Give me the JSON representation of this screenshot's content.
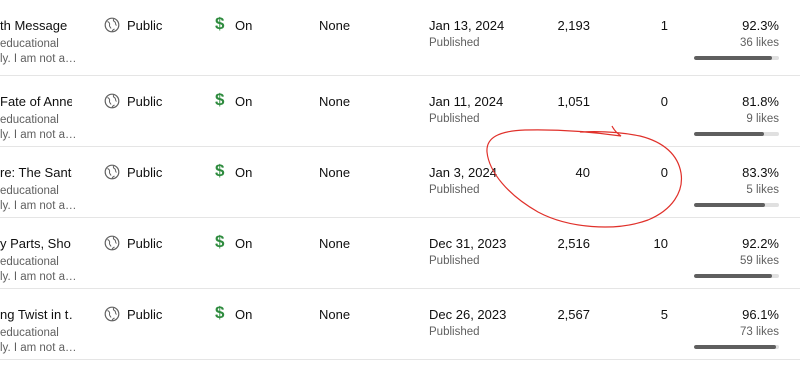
{
  "rows": [
    {
      "title": "th Message …",
      "desc1": "educational",
      "desc2": "ly. I am not a…",
      "visibility": "Public",
      "monetization": "On",
      "restrictions": "None",
      "date": "Jan 13, 2024",
      "status": "Published",
      "views": "2,193",
      "comments": "1",
      "like_pct": "92.3%",
      "likes": "36 likes",
      "like_ratio": 0.923
    },
    {
      "title": "Fate of Anne…",
      "desc1": "educational",
      "desc2": "ly. I am not a…",
      "visibility": "Public",
      "monetization": "On",
      "restrictions": "None",
      "date": "Jan 11, 2024",
      "status": "Published",
      "views": "1,051",
      "comments": "0",
      "like_pct": "81.8%",
      "likes": "9 likes",
      "like_ratio": 0.818
    },
    {
      "title": "re: The Santa…",
      "desc1": "educational",
      "desc2": "ly. I am not a…",
      "visibility": "Public",
      "monetization": "On",
      "restrictions": "None",
      "date": "Jan 3, 2024",
      "status": "Published",
      "views": "40",
      "comments": "0",
      "like_pct": "83.3%",
      "likes": "5 likes",
      "like_ratio": 0.833
    },
    {
      "title": "y Parts, Sho…",
      "desc1": "educational",
      "desc2": "ly. I am not a…",
      "visibility": "Public",
      "monetization": "On",
      "restrictions": "None",
      "date": "Dec 31, 2023",
      "status": "Published",
      "views": "2,516",
      "comments": "10",
      "like_pct": "92.2%",
      "likes": "59 likes",
      "like_ratio": 0.922
    },
    {
      "title": "ng Twist in t…",
      "desc1": "educational",
      "desc2": "ly. I am not a…",
      "visibility": "Public",
      "monetization": "On",
      "restrictions": "None",
      "date": "Dec 26, 2023",
      "status": "Published",
      "views": "2,567",
      "comments": "5",
      "like_pct": "96.1%",
      "likes": "73 likes",
      "like_ratio": 0.961
    }
  ],
  "icons": {
    "visibility": "globe-icon",
    "monetization": "dollar-icon"
  },
  "colors": {
    "monetization_icon": "#2e8b3e",
    "annotation": "#e0302a",
    "bar_fill": "#5f5f5f",
    "bar_track": "#e0e0e0"
  }
}
